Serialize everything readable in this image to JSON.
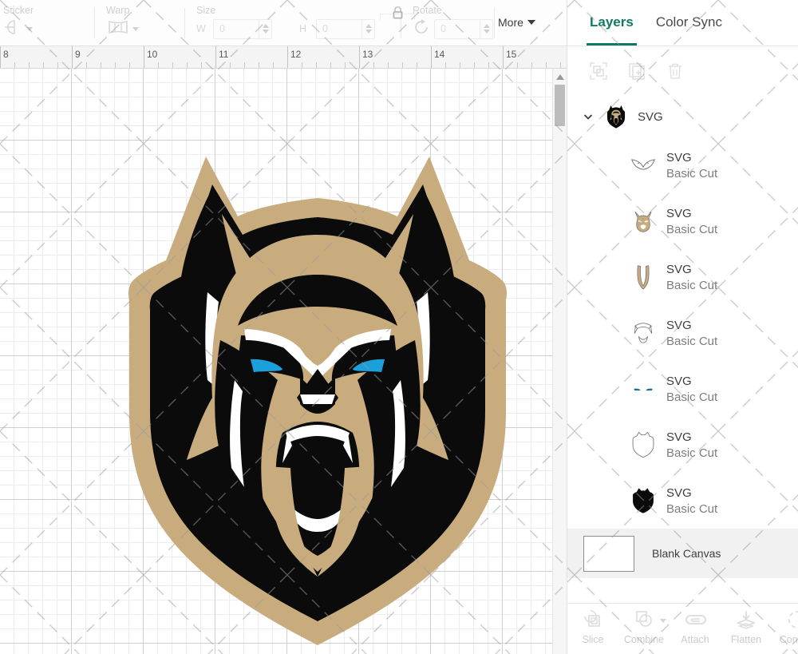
{
  "toolbar": {
    "sticker": {
      "label": "Sticker",
      "icon": "sticker-icon"
    },
    "warp": {
      "label": "Warp",
      "icon": "warp-icon"
    },
    "size": {
      "label": "Size",
      "width_prefix": "W",
      "width_value": "0",
      "height_prefix": "H",
      "height_value": "0",
      "lock_icon": "lock-icon"
    },
    "rotate": {
      "label": "Rotate",
      "value": "0",
      "icon": "rotate-icon"
    },
    "more": {
      "label": "More",
      "caret": "caret-down-icon"
    }
  },
  "ruler": {
    "marks": [
      "8",
      "9",
      "10",
      "11",
      "12",
      "13",
      "14",
      "15"
    ],
    "unit_spacing_px": 90,
    "minor_ticks_per_unit": 5
  },
  "canvas": {
    "scrollbar": {
      "up_arrow": "chevron-up-icon"
    },
    "artwork": {
      "name": "wolf-mascot-shield",
      "colors": {
        "tan": "#C9AC7E",
        "black": "#0B0B0B",
        "white": "#FFFFFF",
        "eye_blue": "#1CA0DC"
      }
    }
  },
  "panel": {
    "tabs": [
      {
        "label": "Layers",
        "active": true
      },
      {
        "label": "Color Sync",
        "active": false
      }
    ],
    "accent_color": "#0E7A5F",
    "actions": [
      {
        "name": "group-layers-button",
        "icon": "group-icon",
        "disabled": true
      },
      {
        "name": "duplicate-layer-button",
        "icon": "duplicate-icon",
        "disabled": true
      },
      {
        "name": "delete-layer-button",
        "icon": "trash-icon",
        "disabled": true
      }
    ],
    "group": {
      "title": "SVG",
      "expanded": true,
      "chevron": "chevron-down-icon",
      "thumbnail": "wolf-shield-thumb"
    },
    "layers": [
      {
        "title": "SVG",
        "subtitle": "Basic Cut",
        "thumbnail": "brow-outline-thumb"
      },
      {
        "title": "SVG",
        "subtitle": "Basic Cut",
        "thumbnail": "wolf-face-tan-thumb"
      },
      {
        "title": "SVG",
        "subtitle": "Basic Cut",
        "thumbnail": "jaw-u-shape-thumb"
      },
      {
        "title": "SVG",
        "subtitle": "Basic Cut",
        "thumbnail": "teeth-thumb"
      },
      {
        "title": "SVG",
        "subtitle": "Basic Cut",
        "thumbnail": "blue-eyes-thumb"
      },
      {
        "title": "SVG",
        "subtitle": "Basic Cut",
        "thumbnail": "shield-outline-thumb"
      },
      {
        "title": "SVG",
        "subtitle": "Basic Cut",
        "thumbnail": "black-shield-thumb"
      }
    ],
    "blank_canvas": {
      "label": "Blank Canvas"
    }
  },
  "bottom_bar": {
    "items": [
      {
        "label": "Slice",
        "icon": "slice-icon",
        "has_caret": false,
        "disabled": true
      },
      {
        "label": "Combine",
        "icon": "combine-icon",
        "has_caret": true,
        "disabled": true
      },
      {
        "label": "Attach",
        "icon": "attach-icon",
        "has_caret": false,
        "disabled": true
      },
      {
        "label": "Flatten",
        "icon": "flatten-icon",
        "has_caret": false,
        "disabled": true
      },
      {
        "label": "Contour",
        "icon": "contour-icon",
        "has_caret": false,
        "disabled": true
      }
    ]
  }
}
